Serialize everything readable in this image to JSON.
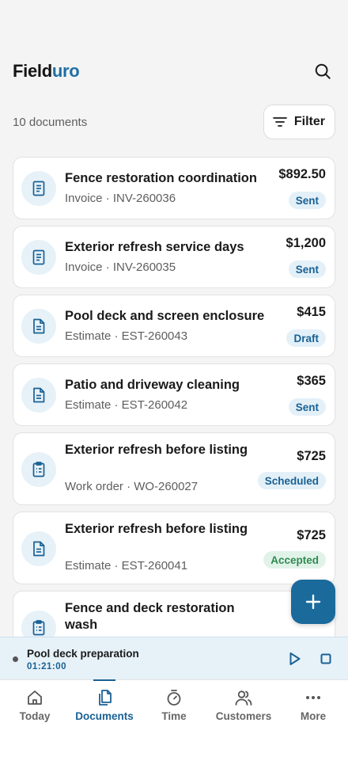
{
  "app": {
    "logo_part1": "Field",
    "logo_part2": "uro"
  },
  "toolbar": {
    "count": "10 documents",
    "filter_label": "Filter"
  },
  "documents": [
    {
      "title": "Fence restoration coordination",
      "subtitle": "Invoice · INV-260036",
      "amount": "$892.50",
      "status": "Sent",
      "icon": "invoice-icon"
    },
    {
      "title": "Exterior refresh service days",
      "subtitle": "Invoice · INV-260035",
      "amount": "$1,200",
      "status": "Sent",
      "icon": "invoice-icon"
    },
    {
      "title": "Pool deck and screen enclosure",
      "subtitle": "Estimate · EST-260043",
      "amount": "$415",
      "status": "Draft",
      "icon": "estimate-icon"
    },
    {
      "title": "Patio and driveway cleaning",
      "subtitle": "Estimate · EST-260042",
      "amount": "$365",
      "status": "Sent",
      "icon": "estimate-icon"
    },
    {
      "title": "Exterior refresh before listing",
      "subtitle": "Work order · WO-260027",
      "amount": "$725",
      "status": "Scheduled",
      "icon": "work-order-icon"
    },
    {
      "title": "Exterior refresh before listing",
      "subtitle": "Estimate · EST-260041",
      "amount": "$725",
      "status": "Accepted",
      "icon": "estimate-icon"
    },
    {
      "title": "Fence and deck restoration wash",
      "subtitle": "",
      "amount": "",
      "status": "",
      "icon": "work-order-icon"
    }
  ],
  "timer": {
    "job": "Pool deck preparation",
    "elapsed": "01:21:00"
  },
  "tabs": [
    {
      "label": "Today",
      "icon": "home-icon"
    },
    {
      "label": "Documents",
      "icon": "documents-icon"
    },
    {
      "label": "Time",
      "icon": "stopwatch-icon"
    },
    {
      "label": "Customers",
      "icon": "people-icon"
    },
    {
      "label": "More",
      "icon": "more-icon"
    }
  ],
  "colors": {
    "accent": "#1a6a9c",
    "brand_blue": "#1f6ea3",
    "accepted_green": "#2f8a52"
  }
}
